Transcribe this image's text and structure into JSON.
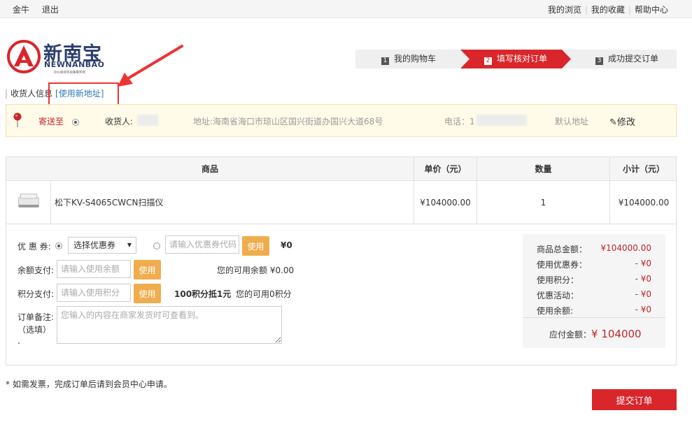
{
  "topbar": {
    "user": "金牛",
    "logout": "退出",
    "links": [
      "我的浏览",
      "我的收藏",
      "帮助中心"
    ]
  },
  "logo": {
    "cn": "新南宝",
    "en": "NEWNANBAO",
    "tagline": "办公自动化设备服务商"
  },
  "steps": [
    {
      "num": "1",
      "label": "我的购物车"
    },
    {
      "num": "2",
      "label": "填写核对订单"
    },
    {
      "num": "3",
      "label": "成功提交订单"
    }
  ],
  "receiver": {
    "title": "收货人信息",
    "new_address": "[使用新地址]",
    "ship_to": "寄送至",
    "person_label": "收货人:",
    "address": "地址:海南省海口市琼山区国兴街道办国兴大道68号",
    "phone_label": "电话：1",
    "default": "默认地址",
    "edit": "修改"
  },
  "table": {
    "headers": [
      "商品",
      "单价（元）",
      "数量",
      "小计（元）"
    ],
    "rows": [
      {
        "name": "松下KV-S4065CWCN扫描仪",
        "price": "¥104000.00",
        "qty": "1",
        "subtotal": "¥104000.00"
      }
    ]
  },
  "form": {
    "coupon_label": "优 惠 券:",
    "coupon_select": "选择优惠券",
    "coupon_code_placeholder": "请输入优惠券代码",
    "use": "使用",
    "coupon_amount": "¥0",
    "balance_label": "余额支付:",
    "balance_placeholder": "请输入使用余额",
    "balance_available": "您的可用余额 ¥0.00",
    "points_label": "积分支付:",
    "points_placeholder": "请输入使用积分",
    "points_rate": "100积分抵1元",
    "points_available": "您的可用0积分",
    "remark_label_1": "订单备注:",
    "remark_label_2": "（选填）",
    "remark_label_3": ".",
    "remark_placeholder": "您输入的内容在商家发货时可查看到。"
  },
  "summary": {
    "lines": [
      {
        "label": "商品总金额：",
        "value": "¥104000.00"
      },
      {
        "label": "使用优惠券：",
        "value": "- ¥0"
      },
      {
        "label": "使用积分：",
        "value": "- ¥0"
      },
      {
        "label": "优惠活动：",
        "value": "- ¥0"
      },
      {
        "label": "使用余额:",
        "value": "- ¥0"
      }
    ],
    "total_label": "应付金额：",
    "total_value": "¥ 104000"
  },
  "footer": {
    "invoice_note": "* 如需发票，完成订单后请到会员中心申请。",
    "submit": "提交订单"
  },
  "colors": {
    "brand_red": "#d9262b",
    "brand_navy": "#2c3e6d",
    "button_yellow": "#f0ad4e",
    "link_blue": "#2e7bb5"
  }
}
